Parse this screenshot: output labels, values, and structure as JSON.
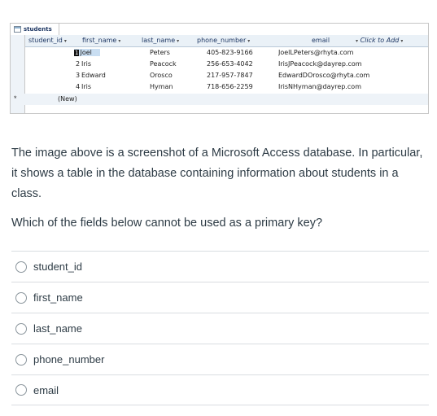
{
  "table": {
    "tab_title": "students",
    "columns": [
      "student_id",
      "first_name",
      "last_name",
      "phone_number",
      "email",
      "Click to Add"
    ],
    "rows": [
      {
        "student_id": "1",
        "first_name": "Joel",
        "last_name": "Peters",
        "phone_number": "405-823-9166",
        "email": "JoelLPeters@rhyta.com"
      },
      {
        "student_id": "2",
        "first_name": "Iris",
        "last_name": "Peacock",
        "phone_number": "256-653-4042",
        "email": "IrisJPeacock@dayrep.com"
      },
      {
        "student_id": "3",
        "first_name": "Edward",
        "last_name": "Orosco",
        "phone_number": "217-957-7847",
        "email": "EdwardDOrosco@rhyta.com"
      },
      {
        "student_id": "4",
        "first_name": "Iris",
        "last_name": "Hyman",
        "phone_number": "718-656-2259",
        "email": "IrisNHyman@dayrep.com"
      }
    ],
    "new_row_label": "(New)",
    "new_row_marker": "*",
    "sort_glyph": "▾"
  },
  "question": {
    "paragraph1": "The image above is a screenshot of a Microsoft Access database. In particular, it shows a table in the database containing information about students in a class.",
    "paragraph2": "Which of the fields below cannot be used as a primary key?"
  },
  "options": [
    {
      "label": "student_id"
    },
    {
      "label": "first_name"
    },
    {
      "label": "last_name"
    },
    {
      "label": "phone_number"
    },
    {
      "label": "email"
    }
  ]
}
